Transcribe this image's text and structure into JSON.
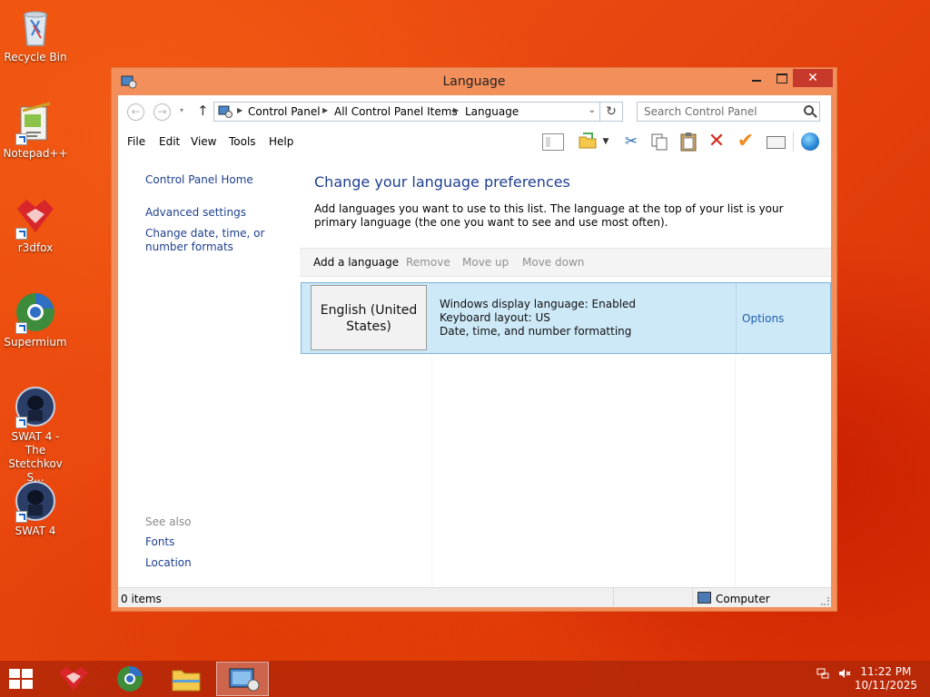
{
  "desktop": {
    "icons": [
      {
        "label": "Recycle Bin"
      },
      {
        "label": "Notepad++"
      },
      {
        "label": "r3dfox"
      },
      {
        "label": "Supermium"
      },
      {
        "label": "SWAT 4 - The Stetchkov S..."
      },
      {
        "label": "SWAT 4"
      }
    ]
  },
  "window": {
    "title": "Language",
    "close_glyph": "✕",
    "nav": {
      "back_glyph": "←",
      "forward_glyph": "→",
      "up_glyph": "↑",
      "dropdown_glyph": "▾",
      "refresh_glyph": "↻",
      "breadcrumbs": [
        "Control Panel",
        "All Control Panel Items",
        "Language"
      ],
      "search_placeholder": "Search Control Panel"
    },
    "menu": [
      "File",
      "Edit",
      "View",
      "Tools",
      "Help"
    ],
    "toolbar_icons": [
      "layout-icon",
      "folder-icon",
      "cut-icon",
      "copy-icon",
      "paste-icon",
      "delete-icon",
      "checkmark-icon",
      "properties-icon",
      "globe-icon"
    ]
  },
  "left_nav": {
    "home": "Control Panel Home",
    "advanced": "Advanced settings",
    "datetime": "Change date, time, or number formats",
    "see_also": "See also",
    "fonts": "Fonts",
    "location": "Location"
  },
  "content": {
    "heading": "Change your language preferences",
    "description": "Add languages you want to use to this list. The language at the top of your list is your primary language (the one you want to see and use most often).",
    "toolbar": {
      "add": "Add a language",
      "remove": "Remove",
      "move_up": "Move up",
      "move_down": "Move down"
    },
    "languages": [
      {
        "name": "English (United States)",
        "display": "Windows display language: Enabled",
        "keyboard": "Keyboard layout: US",
        "formatting": "Date, time, and number formatting",
        "options": "Options"
      }
    ]
  },
  "status_bar": {
    "items": "0 items",
    "location": "Computer"
  },
  "taskbar": {
    "apps": [
      "r3dfox",
      "Supermium",
      "File Explorer",
      "Control Panel"
    ],
    "time": "11:22 PM",
    "date": "10/11/2025"
  },
  "colors": {
    "window_frame": "#f38f5b",
    "close_button": "#c7392b",
    "link": "#1e3f8f",
    "selected_row": "#cde8f7"
  }
}
